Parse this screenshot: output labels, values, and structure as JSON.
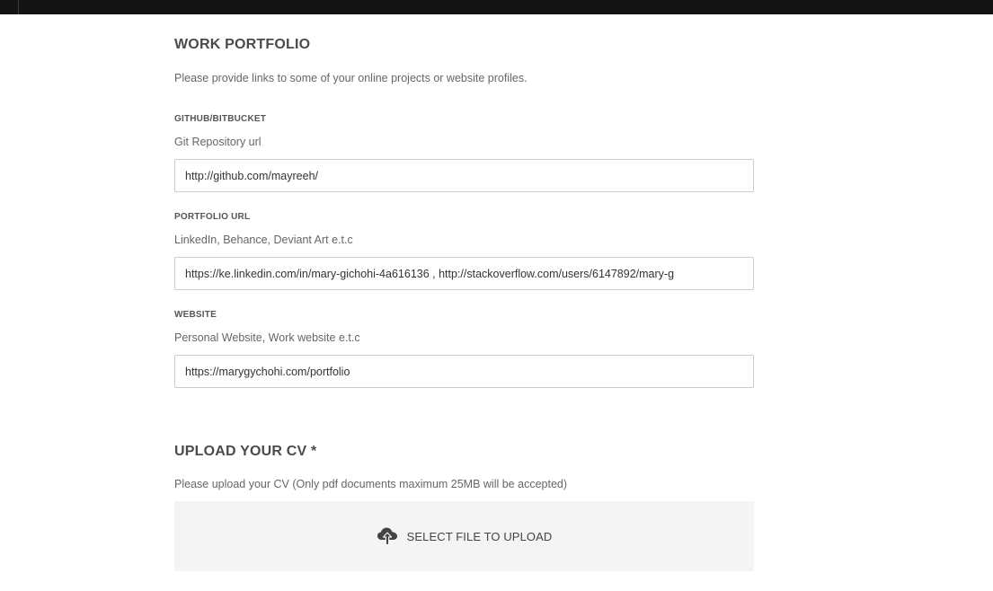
{
  "portfolio": {
    "title": "WORK PORTFOLIO",
    "description": "Please provide links to some of your online projects or website profiles.",
    "fields": [
      {
        "label": "GITHUB/BITBUCKET",
        "hint": "Git Repository url",
        "value": "http://github.com/mayreeh/"
      },
      {
        "label": "PORTFOLIO URL",
        "hint": "LinkedIn, Behance, Deviant Art e.t.c",
        "value": "https://ke.linkedin.com/in/mary-gichohi-4a616136 , http://stackoverflow.com/users/6147892/mary-g"
      },
      {
        "label": "WEBSITE",
        "hint": "Personal Website, Work website e.t.c",
        "value": "https://marygychohi.com/portfolio"
      }
    ]
  },
  "cv": {
    "title": "UPLOAD YOUR CV *",
    "description": "Please upload your CV (Only pdf documents maximum 25MB will be accepted)",
    "upload_label": "SELECT FILE TO UPLOAD",
    "upload_icon": "cloud-upload-icon"
  }
}
